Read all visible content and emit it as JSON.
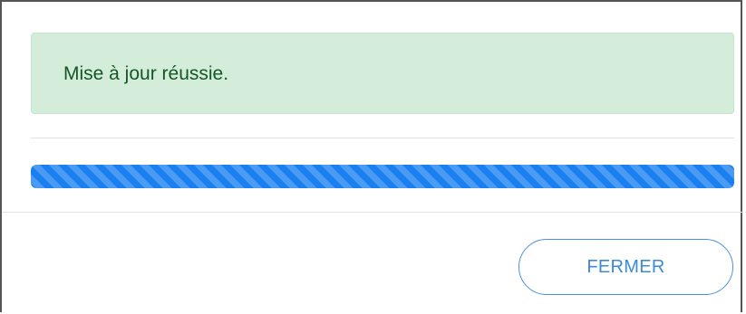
{
  "alert": {
    "message": "Mise à jour réussie.",
    "type": "success",
    "background_color": "#d4edda",
    "text_color": "#155724"
  },
  "progress": {
    "value": 1.0,
    "style": "striped",
    "bar_color": "#1a7ff0"
  },
  "footer": {
    "close_label": "FERMER",
    "accent_color": "#3d8ad8"
  }
}
